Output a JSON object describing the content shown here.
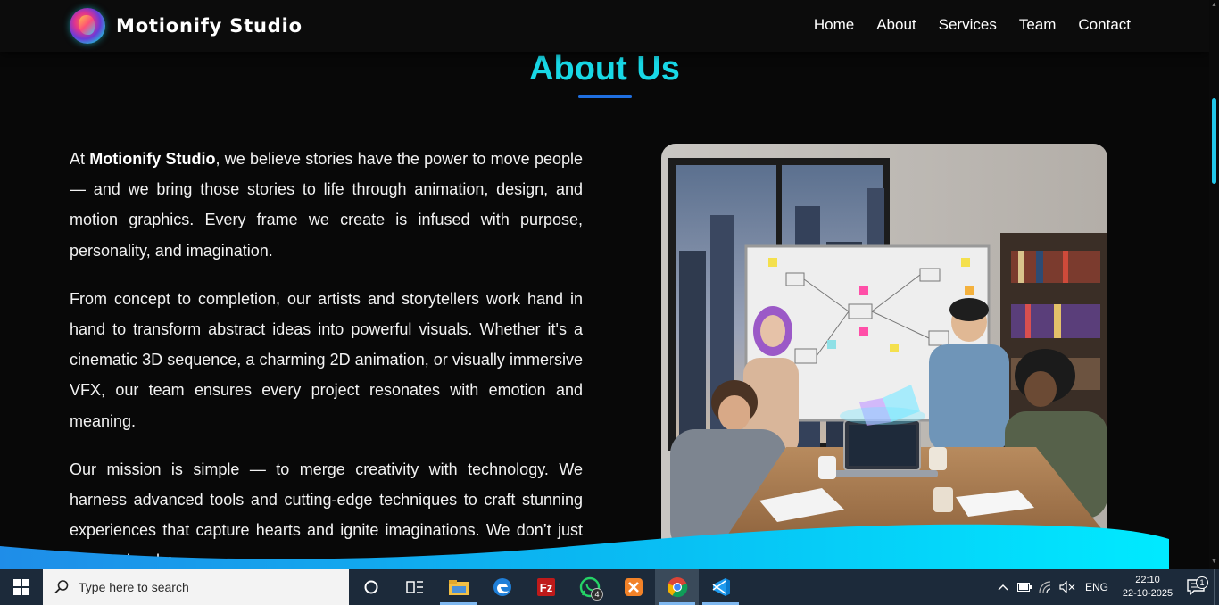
{
  "brand": {
    "name": "Motionify Studio"
  },
  "nav": [
    "Home",
    "About",
    "Services",
    "Team",
    "Contact"
  ],
  "section": {
    "title": "About Us"
  },
  "about": {
    "p1_prefix": "At ",
    "p1_bold": "Motionify Studio",
    "p1_rest": ", we believe stories have the power to move people — and we bring those stories to life through animation, design, and motion graphics. Every frame we create is infused with purpose, personality, and imagination.",
    "p2": "From concept to completion, our artists and storytellers work hand in hand to transform abstract ideas into powerful visuals. Whether it's a cinematic 3D sequence, a charming 2D animation, or visually immersive VFX, our team ensures every project resonates with emotion and meaning.",
    "p3": "Our mission is simple — to merge creativity with technology. We harness advanced tools and cutting-edge techniques to craft stunning experiences that capture hearts and ignite imaginations. We don’t just create visuals;"
  },
  "colors": {
    "accent": "#18d8e6",
    "underline": "#1f6fe0",
    "wave_start": "#1f8de8",
    "wave_end": "#00eaff"
  },
  "taskbar": {
    "search_placeholder": "Type here to search",
    "apps": [
      "cortana-icon",
      "task-view-icon",
      "file-explorer-icon",
      "edge-icon",
      "filezilla-icon",
      "whatsapp-icon",
      "xampp-icon",
      "chrome-icon",
      "vscode-icon"
    ],
    "whatsapp_badge": "4",
    "language": "ENG",
    "time": "22:10",
    "date": "22-10-2025",
    "notification_count": "1"
  }
}
